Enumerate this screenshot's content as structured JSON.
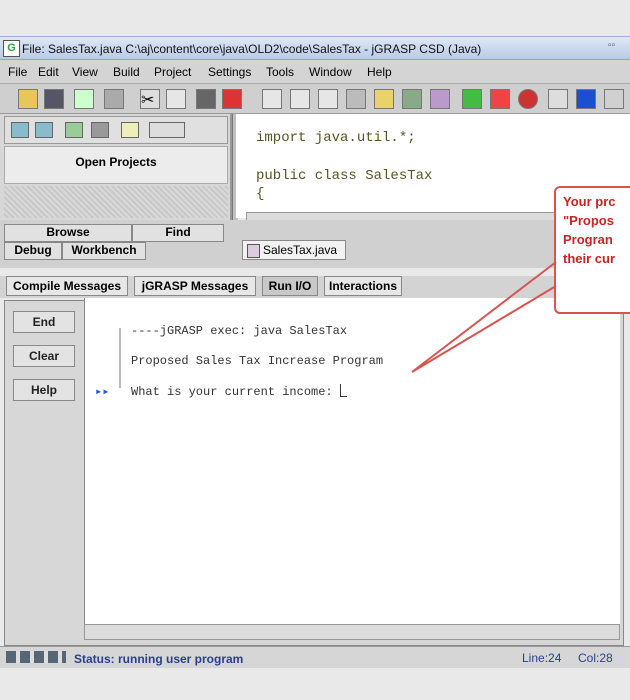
{
  "window": {
    "icon_letter": "G",
    "title": "File: SalesTax.java  C:\\aj\\content\\core\\java\\OLD2\\code\\SalesTax - jGRASP CSD (Java)"
  },
  "menu": [
    "File",
    "Edit",
    "View",
    "Build",
    "Project",
    "Settings",
    "Tools",
    "Window",
    "Help"
  ],
  "project_pane": {
    "header": "Open Projects",
    "tabs": {
      "browse": "Browse",
      "find": "Find",
      "debug": "Debug",
      "workbench": "Workbench"
    }
  },
  "editor": {
    "lines": [
      "import java.util.*;",
      "public class SalesTax",
      "{"
    ],
    "file_tab": "SalesTax.java"
  },
  "message_tabs": [
    "Compile Messages",
    "jGRASP Messages",
    "Run I/O",
    "Interactions"
  ],
  "run_io": {
    "buttons": {
      "end": "End",
      "clear": "Clear",
      "help": "Help"
    },
    "lines": [
      "----jGRASP exec: java SalesTax",
      "Proposed Sales Tax Increase Program",
      "What is your current income: "
    ],
    "prompt_marker": "▸▸"
  },
  "status": {
    "text": "Status: running user program",
    "line": "Line:24",
    "col": "Col:28"
  },
  "callout": [
    "Your prc",
    "\"Propos",
    "Progran",
    "their cur"
  ],
  "colors": {
    "accent_red": "#d9534f",
    "status_blue": "#2a3f90"
  }
}
